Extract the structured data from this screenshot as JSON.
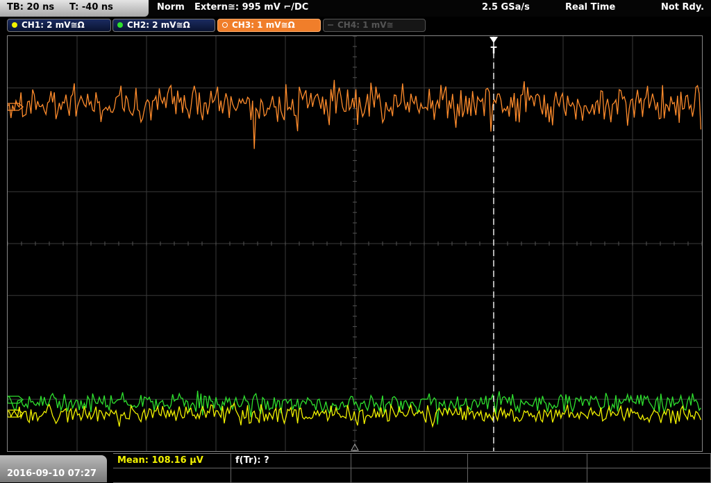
{
  "header": {
    "timebase": "TB: 20 ns",
    "trigger_time": "T: -40 ns",
    "trigger_mode": "Norm",
    "trigger_source": "Extern≅: 995 mV ⌐/DC",
    "sample_rate": "2.5 GSa/s",
    "acq_mode": "Real Time",
    "status": "Not Rdy."
  },
  "channels": [
    {
      "label": "CH1: 2 mV≅Ω",
      "color": "#f2f200",
      "state": "on"
    },
    {
      "label": "CH2: 2 mV≅Ω",
      "color": "#2ee02e",
      "state": "on"
    },
    {
      "label": "CH3: 1 mV≅Ω",
      "color": "#ff8c2c",
      "state": "active"
    },
    {
      "label": "CH4: 1 mV≅",
      "color": "#555555",
      "state": "off"
    }
  ],
  "trigger_marker": "T",
  "footer": {
    "datetime": "2016-09-10 07:27",
    "mean": "Mean: 108.16 µV",
    "freq": "f(Tr): ?"
  },
  "colors": {
    "ch1": "#f2f200",
    "ch2": "#2ee02e",
    "ch3": "#ff8c2c",
    "grid": "#3a3a3a"
  }
}
